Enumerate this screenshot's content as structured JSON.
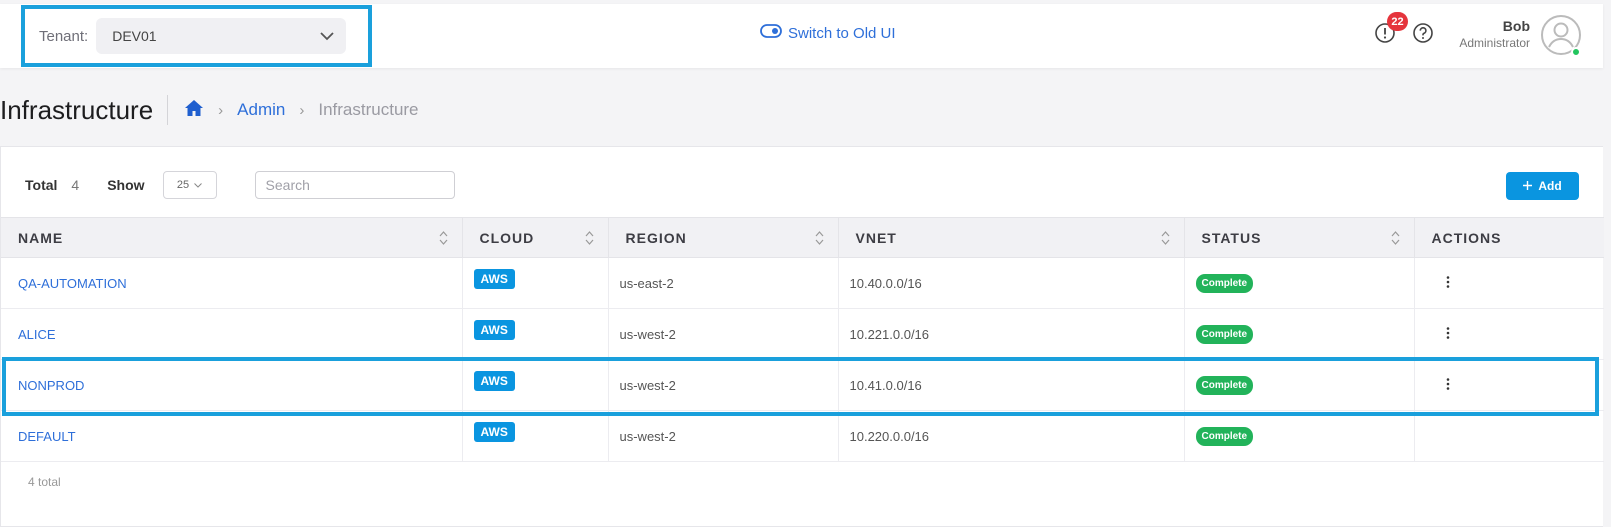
{
  "header": {
    "tenant_label": "Tenant:",
    "tenant_value": "DEV01",
    "switch_ui_label": "Switch to Old UI",
    "notification_count": "22",
    "user_name": "Bob",
    "user_role": "Administrator"
  },
  "page": {
    "title": "Infrastructure",
    "breadcrumb": [
      "Admin",
      "Infrastructure"
    ]
  },
  "toolbar": {
    "total_label": "Total",
    "total_value": "4",
    "show_label": "Show",
    "show_value": "25",
    "search_placeholder": "Search",
    "add_label": "Add"
  },
  "table": {
    "columns": [
      "NAME",
      "CLOUD",
      "REGION",
      "VNET",
      "STATUS",
      "ACTIONS"
    ],
    "rows": [
      {
        "name": "QA-AUTOMATION",
        "cloud": "AWS",
        "region": "us-east-2",
        "vnet": "10.40.0.0/16",
        "status": "Complete"
      },
      {
        "name": "ALICE",
        "cloud": "AWS",
        "region": "us-west-2",
        "vnet": "10.221.0.0/16",
        "status": "Complete"
      },
      {
        "name": "NONPROD",
        "cloud": "AWS",
        "region": "us-west-2",
        "vnet": "10.41.0.0/16",
        "status": "Complete"
      },
      {
        "name": "DEFAULT",
        "cloud": "AWS",
        "region": "us-west-2",
        "vnet": "10.220.0.0/16",
        "status": "Complete"
      }
    ],
    "footer_total": "4 total"
  },
  "colors": {
    "accent": "#2e6fd9",
    "badge_blue": "#0a95e0",
    "status_green": "#22b35a",
    "highlight": "#1aa0dc"
  },
  "icons": {
    "home": "home-icon",
    "alert": "alert-circle-icon",
    "help": "help-circle-icon",
    "toggle": "toggle-icon",
    "user": "user-avatar-icon"
  }
}
